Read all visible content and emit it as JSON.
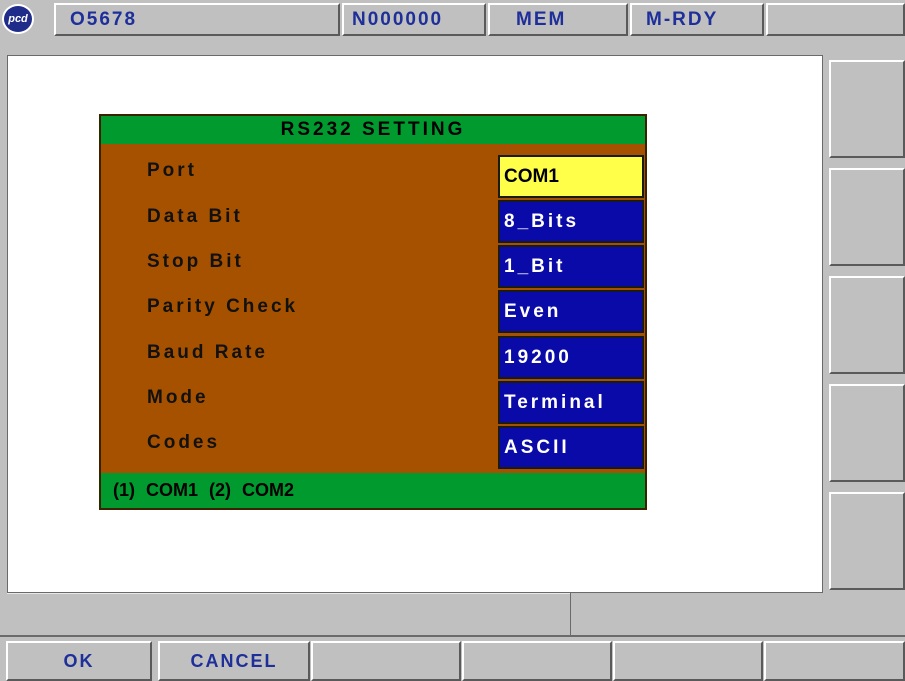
{
  "topbar": {
    "logo": "pcd",
    "program": "O5678",
    "sequence": "N000000",
    "mode": "MEM",
    "status": "M-RDY"
  },
  "dialog": {
    "title": "RS232 SETTING",
    "fields": [
      {
        "label": "Port",
        "value": "COM1"
      },
      {
        "label": "Data Bit",
        "value": "8_Bits"
      },
      {
        "label": "Stop Bit",
        "value": "1_Bit"
      },
      {
        "label": "Parity Check",
        "value": "Even"
      },
      {
        "label": "Baud Rate",
        "value": "19200"
      },
      {
        "label": "Mode",
        "value": "Terminal"
      },
      {
        "label": "Codes",
        "value": "ASCII"
      }
    ],
    "footer": "(1) COM1 (2) COM2"
  },
  "softkeys": {
    "ok": "OK",
    "cancel": "CANCEL"
  },
  "colors": {
    "dialog_bg": "#a65100",
    "header_green": "#009a2e",
    "value_blue": "#0a0aa8",
    "selected_yellow": "#ffff4a",
    "key_text": "#1f2f9a"
  }
}
